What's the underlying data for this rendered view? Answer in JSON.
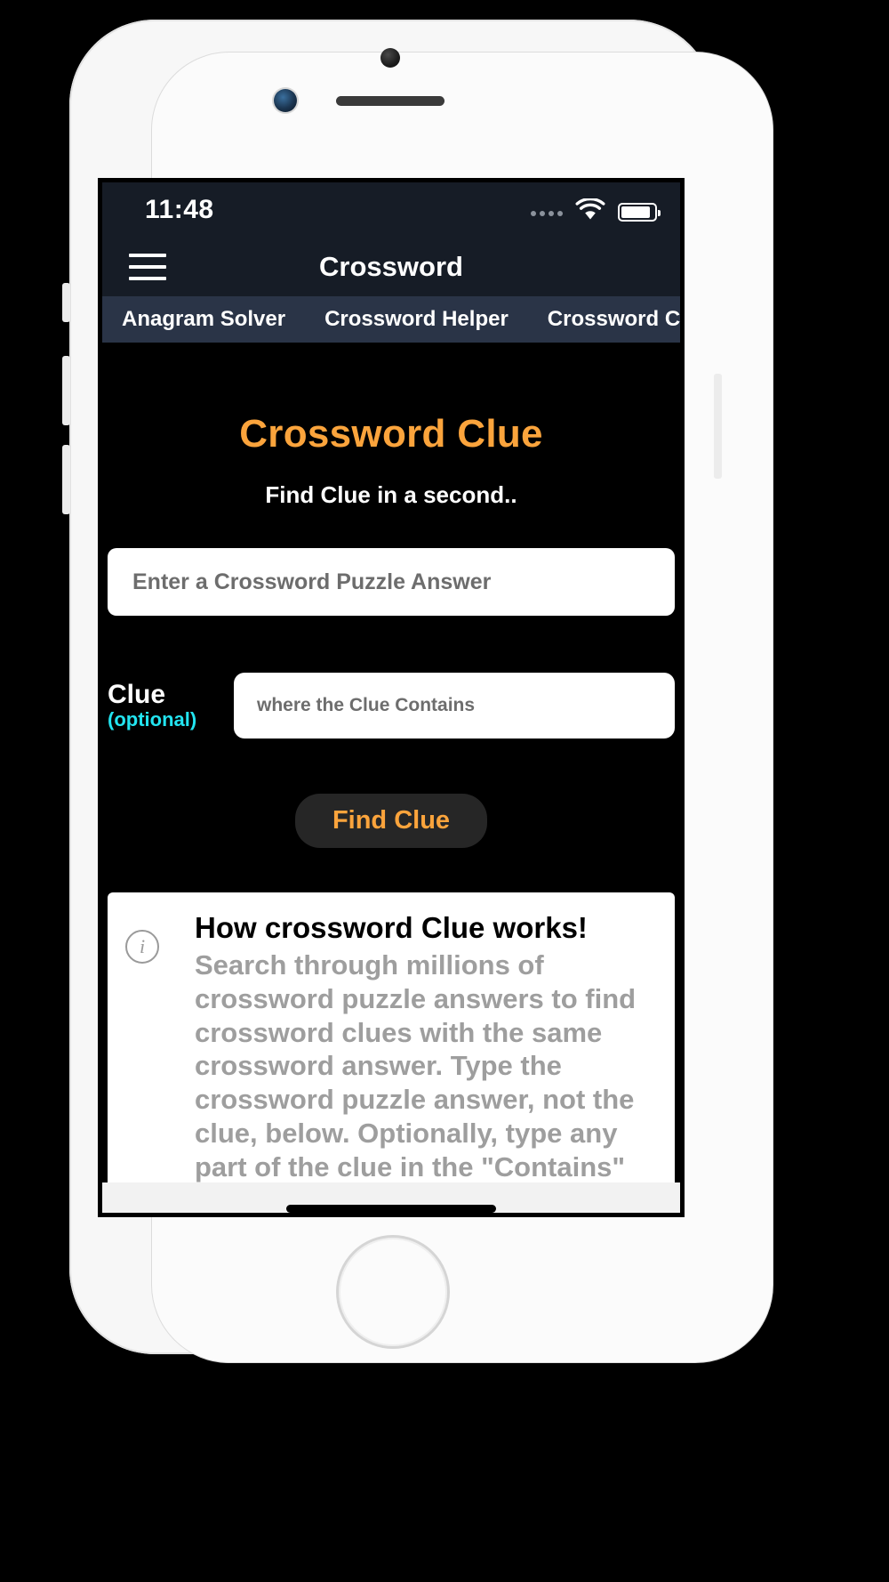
{
  "device": {
    "frame_name": "white-iphone",
    "icons": {
      "front_camera": "front-camera-icon",
      "earpiece": "earpiece-speaker-icon",
      "home_button": "home-button"
    }
  },
  "status_bar": {
    "time": "11:48",
    "signal_icon": "signal-dots-icon",
    "wifi_icon": "wifi-icon",
    "battery_icon": "battery-icon",
    "battery_level": 90,
    "background": "#161c26"
  },
  "app_bar": {
    "menu_icon": "hamburger-menu-icon",
    "title": "Crossword",
    "background": "#161c26"
  },
  "tabs": [
    {
      "label": "Anagram Solver"
    },
    {
      "label": "Crossword Helper"
    },
    {
      "label": "Crossword Clue"
    }
  ],
  "hero": {
    "title": "Crossword Clue",
    "title_color": "#FBA43C",
    "subtitle": "Find Clue in a second.."
  },
  "answer_input": {
    "placeholder": "Enter a Crossword Puzzle Answer",
    "value": ""
  },
  "clue": {
    "label": "Clue",
    "optional_label": "(optional)",
    "optional_color": "#22E4F0",
    "placeholder": "where the Clue Contains",
    "value": ""
  },
  "find_button": {
    "label": "Find Clue",
    "text_color": "#FBA43C",
    "background": "#262626"
  },
  "info_card": {
    "icon": "info-circle-icon",
    "heading": "How crossword Clue works!",
    "body": "Search through millions of crossword puzzle answers to find crossword clues with the same crossword answer. Type the crossword puzzle answer, not the clue, below. Optionally, type any part of the clue in the \"Contains\" box. Click on clues to find other crossword"
  },
  "home_indicator": {
    "name": "home-indicator-bar"
  }
}
